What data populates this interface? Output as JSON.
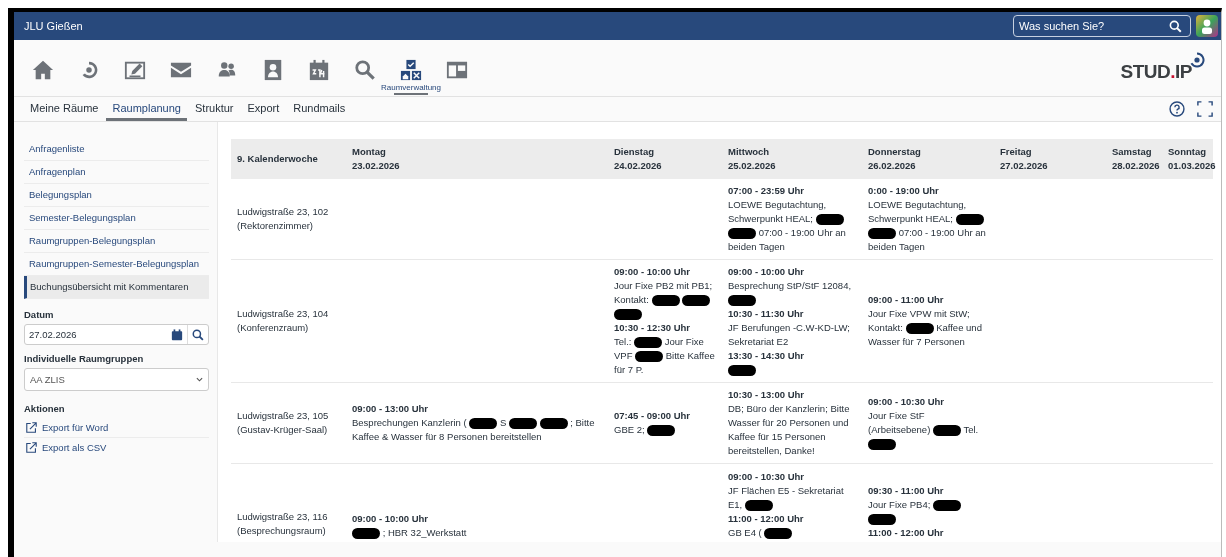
{
  "top_bar": {
    "title": "JLU Gießen",
    "search": {
      "placeholder": "Was suchen Sie?"
    }
  },
  "nav_icons": [
    {
      "selected": false
    },
    {
      "selected": false
    },
    {
      "selected": false
    },
    {
      "selected": false
    },
    {
      "selected": false
    },
    {
      "selected": false
    },
    {
      "selected": false
    },
    {
      "selected": false
    },
    {
      "selected": true,
      "label": "Raumverwaltung"
    },
    {
      "selected": false
    }
  ],
  "logo": [
    {
      "text": "STUD",
      "color": "#3c4043"
    },
    {
      "text": ".",
      "color": "#c8102e"
    },
    {
      "text": "IP",
      "color": "#3c4043"
    }
  ],
  "tabs": [
    {
      "label": "Meine Räume",
      "selected": false
    },
    {
      "label": "Raumplanung",
      "selected": true
    },
    {
      "label": "Struktur",
      "selected": false
    },
    {
      "label": "Export",
      "selected": false
    },
    {
      "label": "Rundmails",
      "selected": false
    }
  ],
  "sidebar": {
    "items": [
      {
        "label": "Anfragenliste",
        "selected": false
      },
      {
        "label": "Anfragenplan",
        "selected": false
      },
      {
        "label": "Belegungsplan",
        "selected": false
      },
      {
        "label": "Semester-Belegungsplan",
        "selected": false
      },
      {
        "label": "Raumgruppen-Belegungsplan",
        "selected": false
      },
      {
        "label": "Raumgruppen-Semester-Belegungsplan",
        "selected": false
      },
      {
        "label": "Buchungsübersicht mit Kommentaren",
        "selected": true
      }
    ],
    "date": {
      "label": "Datum",
      "value": "27.02.2026"
    },
    "group": {
      "label": "Individuelle Raumgruppen",
      "value": "AA ZLIS"
    },
    "actions": {
      "title": "Aktionen",
      "items": [
        "Export für Word",
        "Export als CSV"
      ]
    }
  },
  "table": {
    "columns": [
      {
        "title": "9. Kalenderwoche"
      },
      {
        "title": "Montag",
        "date": "23.02.2026"
      },
      {
        "title": "Dienstag",
        "date": "24.02.2026"
      },
      {
        "title": "Mittwoch",
        "date": "25.02.2026"
      },
      {
        "title": "Donnerstag",
        "date": "26.02.2026"
      },
      {
        "title": "Freitag",
        "date": "27.02.2026"
      },
      {
        "title": "Samstag",
        "date": "28.02.2026"
      },
      {
        "title": "Sonntag",
        "date": "01.03.2026"
      }
    ],
    "rows": [
      {
        "room": "Ludwigstraße 23, 102",
        "room_name": "(Rektorenzimmer)",
        "days": {
          "wed": [
            {
              "time": "07:00 - 23:59 Uhr",
              "parts": [
                {
                  "kind": "text",
                  "text": "LOEWE Begutachtung, Schwerpunkt HEAL;"
                },
                {
                  "kind": "redaction"
                },
                {
                  "kind": "redaction"
                },
                {
                  "kind": "text",
                  "text": "07:00 - 19:00 Uhr an beiden Tagen"
                }
              ]
            }
          ],
          "thu": [
            {
              "time": "0:00 - 19:00 Uhr",
              "parts": [
                {
                  "kind": "text",
                  "text": "LOEWE Begutachtung, Schwerpunkt HEAL;"
                },
                {
                  "kind": "redaction"
                },
                {
                  "kind": "redaction"
                },
                {
                  "kind": "text",
                  "text": "07:00 - 19:00 Uhr an beiden Tagen"
                }
              ]
            }
          ]
        }
      },
      {
        "room": "Ludwigstraße 23, 104",
        "room_name": "(Konferenzraum)",
        "days": {
          "tue": [
            {
              "time": "09:00 - 10:00 Uhr",
              "parts": [
                {
                  "kind": "text",
                  "text": "Jour Fixe PB2 mit PB1; Kontakt:"
                },
                {
                  "kind": "redaction"
                },
                {
                  "kind": "redaction"
                },
                {
                  "kind": "redaction"
                }
              ]
            },
            {
              "time": "10:30 - 12:30 Uhr",
              "parts": [
                {
                  "kind": "text",
                  "text": "Tel.:"
                },
                {
                  "kind": "redaction"
                },
                {
                  "kind": "text",
                  "text": "Jour Fixe VPF"
                },
                {
                  "kind": "redaction"
                },
                {
                  "kind": "text",
                  "text": "Bitte Kaffee für 7 P."
                }
              ]
            }
          ],
          "wed": [
            {
              "time": "09:00 - 10:00 Uhr",
              "parts": [
                {
                  "kind": "text",
                  "text": "Besprechung StP/StF 12084,"
                },
                {
                  "kind": "redaction"
                }
              ]
            },
            {
              "time": "10:30 - 11:30 Uhr",
              "parts": [
                {
                  "kind": "text",
                  "text": "JF Berufungen -C.W-KD-LW; Sekretariat E2"
                }
              ]
            },
            {
              "time": "13:30 - 14:30 Uhr",
              "parts": [
                {
                  "kind": "redaction"
                }
              ]
            }
          ],
          "thu": [
            {
              "time": "09:00 - 11:00 Uhr",
              "parts": [
                {
                  "kind": "text",
                  "text": "Jour Fixe VPW mit StW; Kontakt:"
                },
                {
                  "kind": "redaction"
                },
                {
                  "kind": "text",
                  "text": "Kaffee und Wasser für 7 Personen"
                }
              ]
            }
          ]
        }
      },
      {
        "room": "Ludwigstraße 23, 105",
        "room_name": "(Gustav-Krüger-Saal)",
        "days": {
          "mon": [
            {
              "time": "09:00 - 13:00 Uhr",
              "parts": [
                {
                  "kind": "text",
                  "text": "Besprechungen Kanzlerin ("
                },
                {
                  "kind": "redaction"
                },
                {
                  "kind": "text",
                  "text": "S"
                },
                {
                  "kind": "redaction"
                },
                {
                  "kind": "redaction"
                },
                {
                  "kind": "text",
                  "text": "; Bitte Kaffee & Wasser für 8 Personen bereitstellen"
                }
              ]
            }
          ],
          "tue": [
            {
              "time": "07:45 - 09:00 Uhr",
              "parts": [
                {
                  "kind": "text",
                  "text": "GBE 2;"
                },
                {
                  "kind": "redaction"
                }
              ]
            }
          ],
          "wed": [
            {
              "time": "10:30 - 13:00 Uhr",
              "parts": [
                {
                  "kind": "text",
                  "text": "DB; Büro der Kanzlerin; Bitte Wasser für 20 Personen und Kaffee für 15 Personen bereitstellen, Danke!"
                }
              ]
            }
          ],
          "thu": [
            {
              "time": "09:00 - 10:30 Uhr",
              "parts": [
                {
                  "kind": "text",
                  "text": "Jour Fixe StF (Arbeitsebene)"
                },
                {
                  "kind": "redaction"
                },
                {
                  "kind": "text",
                  "text": "Tel."
                },
                {
                  "kind": "redaction"
                }
              ]
            }
          ]
        }
      },
      {
        "room": "Ludwigstraße 23, 116",
        "room_name": "(Besprechungsraum)",
        "days": {
          "mon": [
            {
              "time": "09:00 - 10:00 Uhr",
              "parts": [
                {
                  "kind": "redaction"
                },
                {
                  "kind": "text",
                  "text": "; HBR 32_Werkstatt"
                }
              ]
            }
          ],
          "wed": [
            {
              "time": "09:00 - 10:30 Uhr",
              "parts": [
                {
                  "kind": "text",
                  "text": "JF Flächen E5 - Sekretariat E1,"
                },
                {
                  "kind": "redaction"
                }
              ]
            },
            {
              "time": "11:00 - 12:00 Uhr",
              "parts": [
                {
                  "kind": "text",
                  "text": "GB E4 ("
                },
                {
                  "kind": "redaction"
                }
              ]
            }
          ],
          "thu": [
            {
              "time": "09:30 - 11:00 Uhr",
              "parts": [
                {
                  "kind": "text",
                  "text": "Jour Fixe PB4;"
                },
                {
                  "kind": "redaction"
                },
                {
                  "kind": "redaction"
                }
              ]
            },
            {
              "time": "11:00 - 12:00 Uhr"
            }
          ]
        }
      }
    ]
  }
}
